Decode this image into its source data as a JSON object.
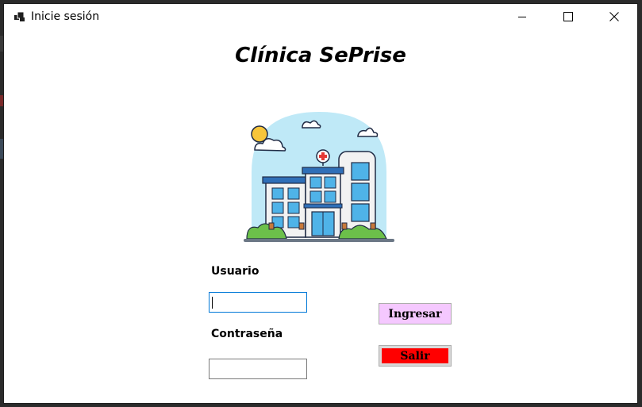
{
  "window": {
    "title": "Inicie sesión",
    "icons": {
      "app": "app-icon",
      "minimize": "minimize-icon",
      "maximize": "maximize-icon",
      "close": "close-icon"
    }
  },
  "main": {
    "heading": "Clínica SePrise",
    "illustration": "hospital-illustration"
  },
  "form": {
    "user_label": "Usuario",
    "user_value": "",
    "password_label": "Contraseña",
    "password_value": "",
    "login_button": "Ingresar",
    "exit_button": "Salir"
  },
  "colors": {
    "login_button_bg": "#f5c8ff",
    "exit_button_bg": "#ff0000",
    "focus_border": "#0078d7"
  }
}
